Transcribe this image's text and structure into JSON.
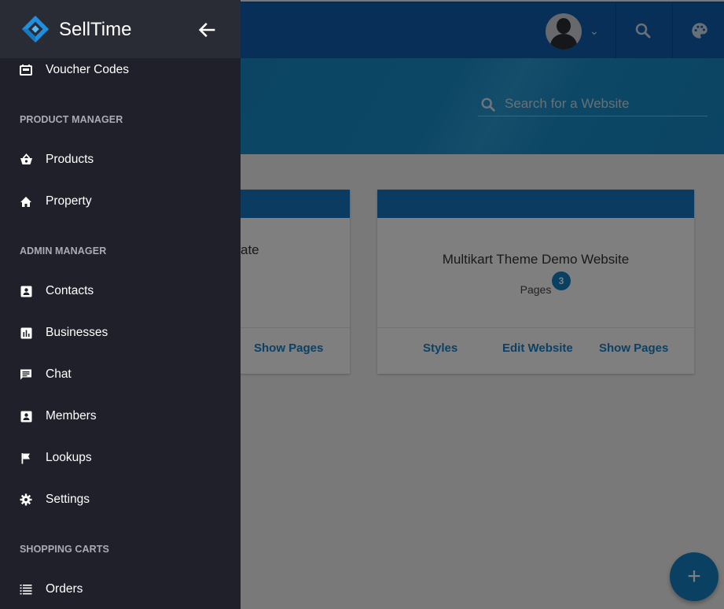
{
  "app": {
    "brand": "SellTime"
  },
  "header": {
    "search_placeholder": "Search for a Website"
  },
  "sidebar": {
    "top_items": [
      {
        "label": "Voucher Codes",
        "icon": "ticket-icon"
      }
    ],
    "sections": [
      {
        "title": "PRODUCT MANAGER",
        "items": [
          {
            "label": "Products",
            "icon": "basket-icon"
          },
          {
            "label": "Property",
            "icon": "home-icon"
          }
        ]
      },
      {
        "title": "ADMIN MANAGER",
        "items": [
          {
            "label": "Contacts",
            "icon": "contact-card-icon"
          },
          {
            "label": "Businesses",
            "icon": "chart-icon"
          },
          {
            "label": "Chat",
            "icon": "chat-icon"
          },
          {
            "label": "Members",
            "icon": "member-card-icon"
          },
          {
            "label": "Lookups",
            "icon": "flag-icon"
          },
          {
            "label": "Settings",
            "icon": "gear-icon"
          }
        ]
      },
      {
        "title": "SHOPPING CARTS",
        "items": [
          {
            "label": "Orders",
            "icon": "list-icon"
          }
        ]
      }
    ]
  },
  "cards": [
    {
      "title_visible": "ate",
      "actions": [
        "Show Pages"
      ]
    },
    {
      "title": "Multikart Theme Demo Website",
      "pages_label": "Pages",
      "pages_count": "3",
      "actions": [
        "Styles",
        "Edit Website",
        "Show Pages"
      ]
    }
  ],
  "fab": {
    "label": "+"
  },
  "colors": {
    "primary": "#0f5fae",
    "accent": "#1582c4",
    "drawer_bg": "#1f2029"
  }
}
